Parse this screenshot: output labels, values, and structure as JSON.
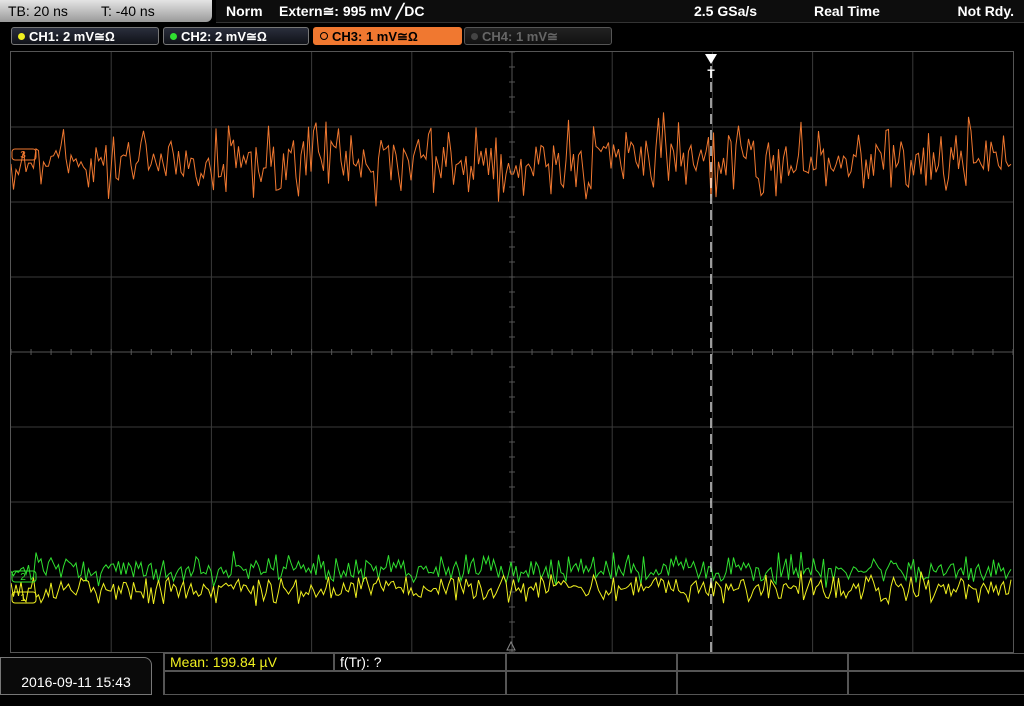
{
  "timebase": {
    "tb": "TB: 20 ns",
    "t": "T: -40 ns"
  },
  "status": {
    "mode": "Norm",
    "trigger": "Extern≅: 995 mV ╱DC",
    "sample_rate": "2.5 GSa/s",
    "acq_mode": "Real Time",
    "state": "Not Rdy."
  },
  "channels": [
    {
      "label": "CH1: 2 mV≅Ω",
      "color": "#f0f020",
      "state": "on"
    },
    {
      "label": "CH2: 2 mV≅Ω",
      "color": "#30e030",
      "state": "on"
    },
    {
      "label": "CH3: 1 mV≅Ω",
      "color": "#f07830",
      "state": "active"
    },
    {
      "label": "CH4: 1 mV≅",
      "color": "#666666",
      "state": "off"
    }
  ],
  "markers": {
    "trigger": "T",
    "ch3": "3",
    "ch2": "2",
    "ch1": "1"
  },
  "waveforms": {
    "ch3_color": "#f07830",
    "ch2_color": "#30e030",
    "ch1_color": "#f0f020",
    "ch3_level_div": 2.55,
    "ch2_level_div": -2.9,
    "ch1_level_div": -3.15
  },
  "bottom": {
    "datetime": "2016-09-11 15:43",
    "mean": "Mean: 199.84 µV",
    "ftr": "f(Tr): ?"
  }
}
